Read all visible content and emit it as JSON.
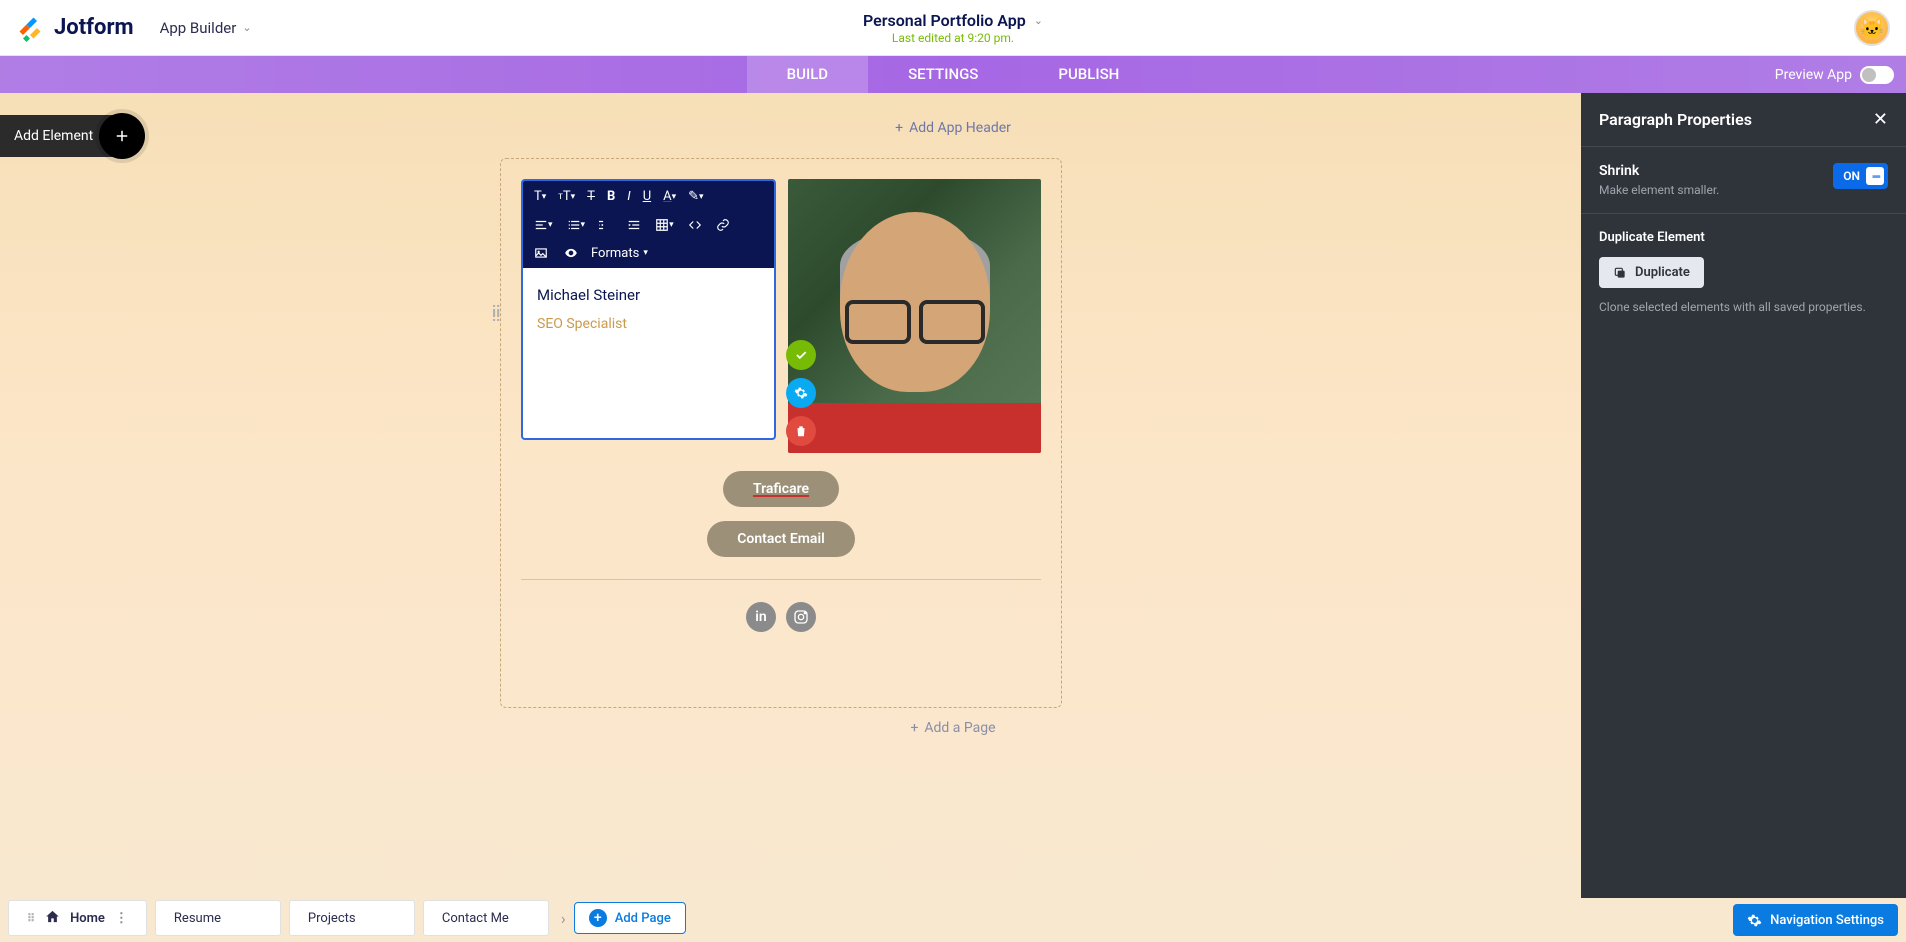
{
  "header": {
    "logo_text": "Jotform",
    "app_builder": "App Builder",
    "app_title": "Personal Portfolio App",
    "last_edited": "Last edited at 9:20 pm."
  },
  "nav": {
    "build": "BUILD",
    "settings": "SETTINGS",
    "publish": "PUBLISH",
    "preview": "Preview App"
  },
  "add_element": "Add Element",
  "add_app_header": "Add App Header",
  "editor": {
    "formats": "Formats",
    "name": "Michael Steiner",
    "role": "SEO Specialist",
    "btn1": "Traficare",
    "btn2": "Contact Email"
  },
  "add_a_page": "Add a Page",
  "props": {
    "title": "Paragraph Properties",
    "shrink": "Shrink",
    "shrink_desc": "Make element smaller.",
    "on": "ON",
    "dup_label": "Duplicate Element",
    "dup_btn": "Duplicate",
    "dup_desc": "Clone selected elements with all saved properties."
  },
  "pages": {
    "home": "Home",
    "resume": "Resume",
    "projects": "Projects",
    "contact": "Contact Me",
    "add": "Add Page"
  },
  "nav_settings": "Navigation Settings"
}
